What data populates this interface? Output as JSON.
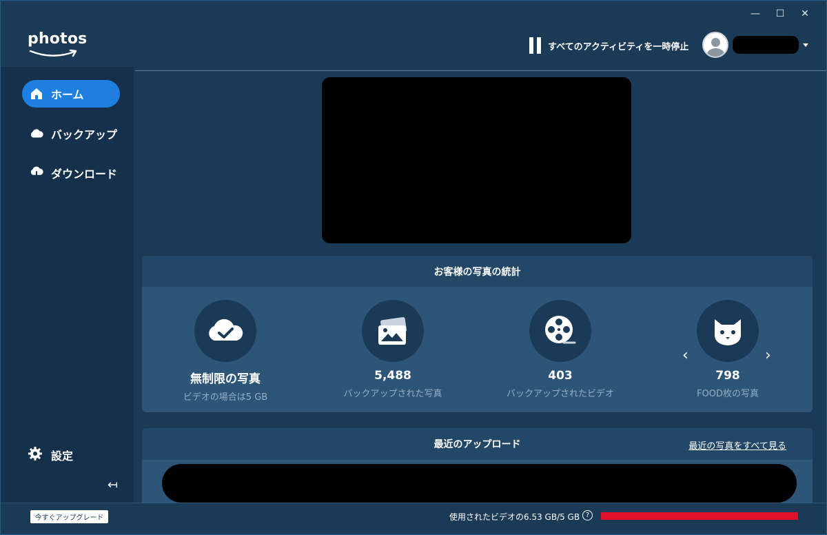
{
  "app": {
    "logo_text": "photos",
    "window_controls": [
      "—",
      "☐",
      "✕"
    ]
  },
  "header": {
    "pause_label": "すべてのアクティビティを一時停止",
    "account_name_redacted": true
  },
  "sidebar": {
    "items": [
      {
        "label": "ホーム",
        "icon": "home-icon",
        "active": true
      },
      {
        "label": "バックアップ",
        "icon": "cloud-icon",
        "active": false
      },
      {
        "label": "ダウンロード",
        "icon": "cloud-download-icon",
        "active": false
      }
    ],
    "settings_label": "設定",
    "collapse_glyph": "↤"
  },
  "stats": {
    "title": "お客様の写真の統計",
    "items": [
      {
        "value": "無制限の写真",
        "sub": "ビデオの場合は5 GB",
        "icon": "cloud-check-icon"
      },
      {
        "value": "5,488",
        "sub": "バックアップされた写真",
        "icon": "photo-icon"
      },
      {
        "value": "403",
        "sub": "バックアップされたビデオ",
        "icon": "film-reel-icon"
      },
      {
        "value": "798",
        "sub": "FOOD枚の写真",
        "icon": "cat-icon"
      }
    ],
    "prev_glyph": "‹",
    "next_glyph": "›"
  },
  "uploads": {
    "title": "最近のアップロード",
    "see_all": "最近の写真をすべて見る"
  },
  "footer": {
    "upgrade_label": "今すぐアップグレード",
    "usage_text": "使用されたビデオの6.53 GB/5 GB",
    "help_glyph": "?",
    "usage_fraction": 1.0,
    "usage_color": "#e0102a"
  },
  "colors": {
    "accent": "#1f7fe0",
    "background": "#1b3a55",
    "card": "#2c5577"
  }
}
